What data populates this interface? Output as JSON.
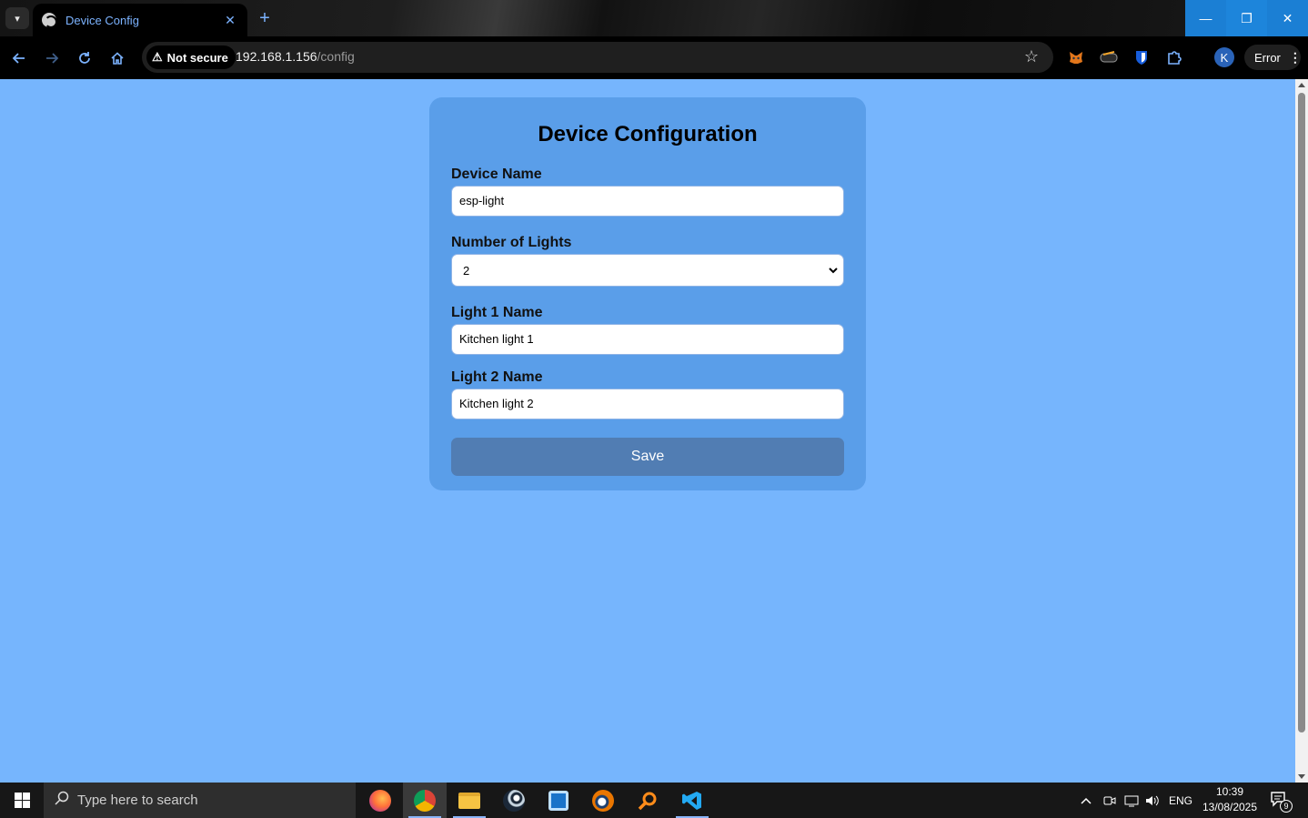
{
  "browser": {
    "tab": {
      "title": "Device Config",
      "close": "✕"
    },
    "new_tab": "+",
    "security": {
      "label": "Not secure"
    },
    "url": {
      "host": "192.168.1.156",
      "path": "/config"
    },
    "error_chip": {
      "label": "Error"
    },
    "profile_initial": "K",
    "window_controls": {
      "minimize": "—",
      "maximize": "❐",
      "close": "✕"
    }
  },
  "page": {
    "title": "Device Configuration",
    "fields": [
      {
        "label": "Device Name",
        "value": "esp-light"
      },
      {
        "label": "Number of Lights",
        "value": "2"
      },
      {
        "label": "Light 1 Name",
        "value": "Kitchen light 1"
      },
      {
        "label": "Light 2 Name",
        "value": "Kitchen light 2"
      }
    ],
    "save_label": "Save"
  },
  "taskbar": {
    "search_placeholder": "Type here to search",
    "language": "ENG",
    "time": "10:39",
    "date": "13/08/2025",
    "notification_count": "9",
    "apps": [
      "firefox",
      "chrome",
      "file-explorer",
      "steam",
      "app-c",
      "blender",
      "search-tool",
      "vscode"
    ]
  },
  "colors": {
    "page_bg": "#76b5fd",
    "card_bg": "#5a9ee9",
    "save_button": "#517db3",
    "accent": "#7cb3ff",
    "window_controls": "#1b7fd4"
  }
}
